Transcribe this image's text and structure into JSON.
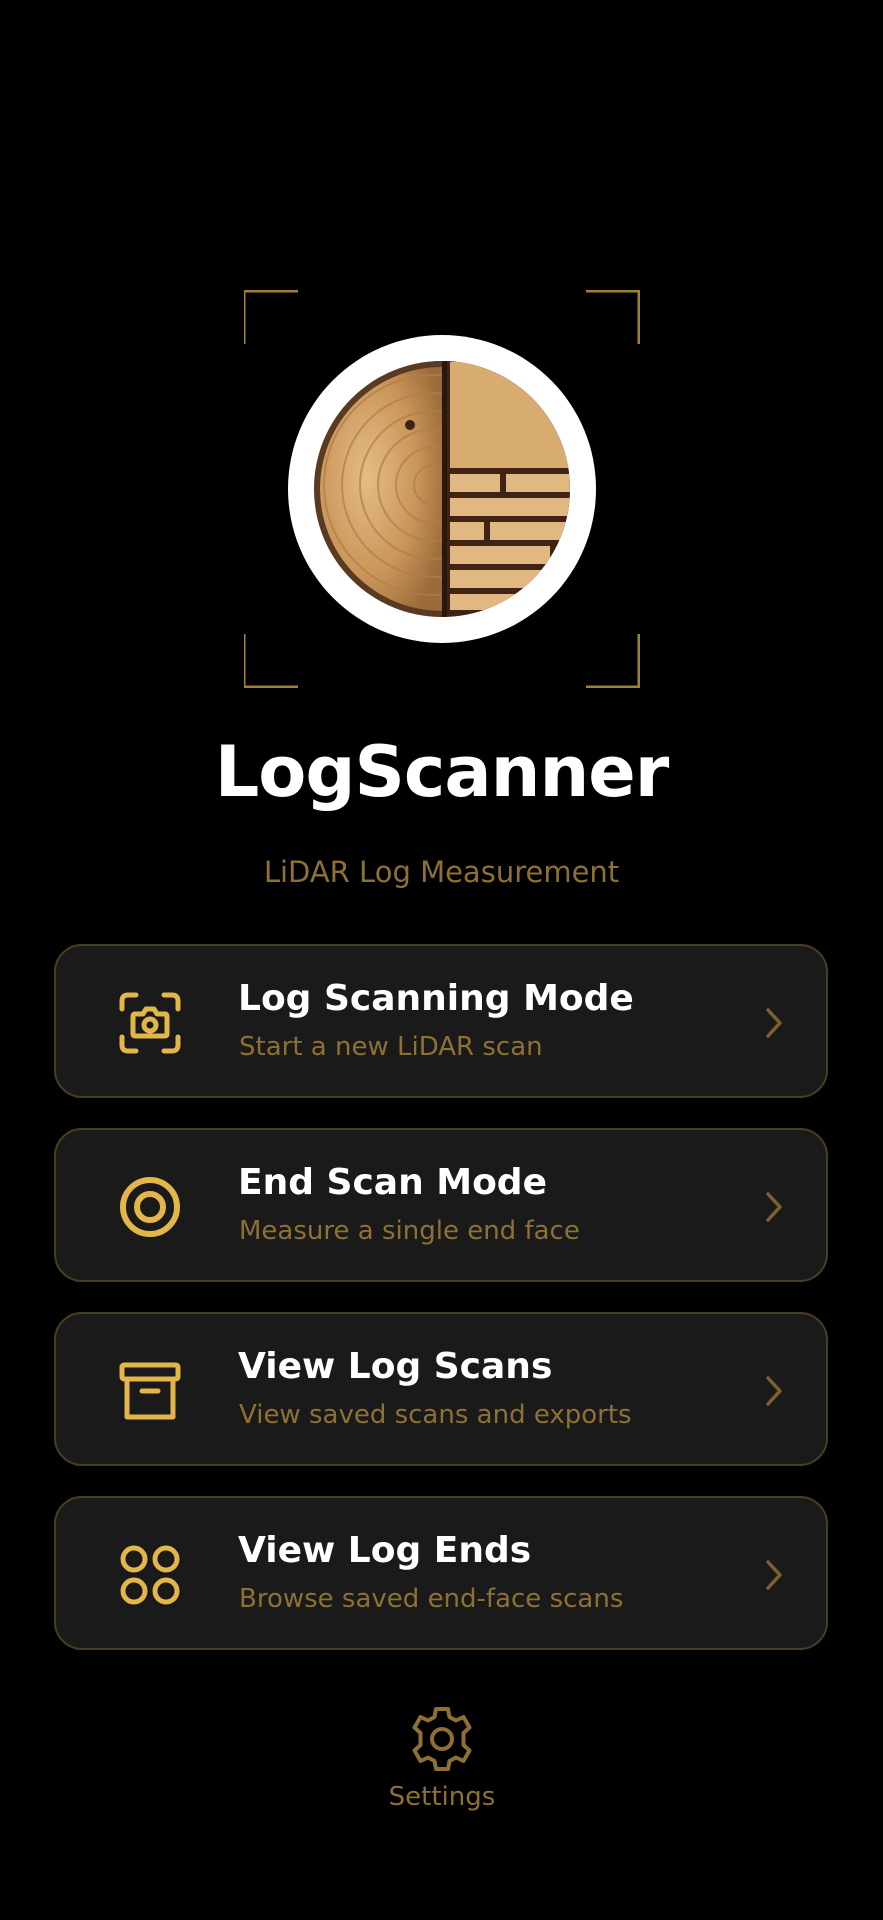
{
  "app": {
    "title": "LogScanner",
    "subtitle": "LiDAR Log Measurement"
  },
  "menu": [
    {
      "title": "Log Scanning Mode",
      "subtitle": "Start a new LiDAR scan",
      "icon": "camera-scan-icon"
    },
    {
      "title": "End Scan Mode",
      "subtitle": "Measure a single end face",
      "icon": "target-icon"
    },
    {
      "title": "View Log Scans",
      "subtitle": "View saved scans and exports",
      "icon": "archive-box-icon"
    },
    {
      "title": "View Log Ends",
      "subtitle": "Browse saved end-face scans",
      "icon": "grid-circles-icon"
    }
  ],
  "settings": {
    "label": "Settings",
    "icon": "gear-icon"
  },
  "colors": {
    "background": "#000000",
    "accent": "#e3b64a",
    "muted_gold": "#8e7034",
    "card_background": "#1a1a1a",
    "card_border": "#4a3e22"
  }
}
